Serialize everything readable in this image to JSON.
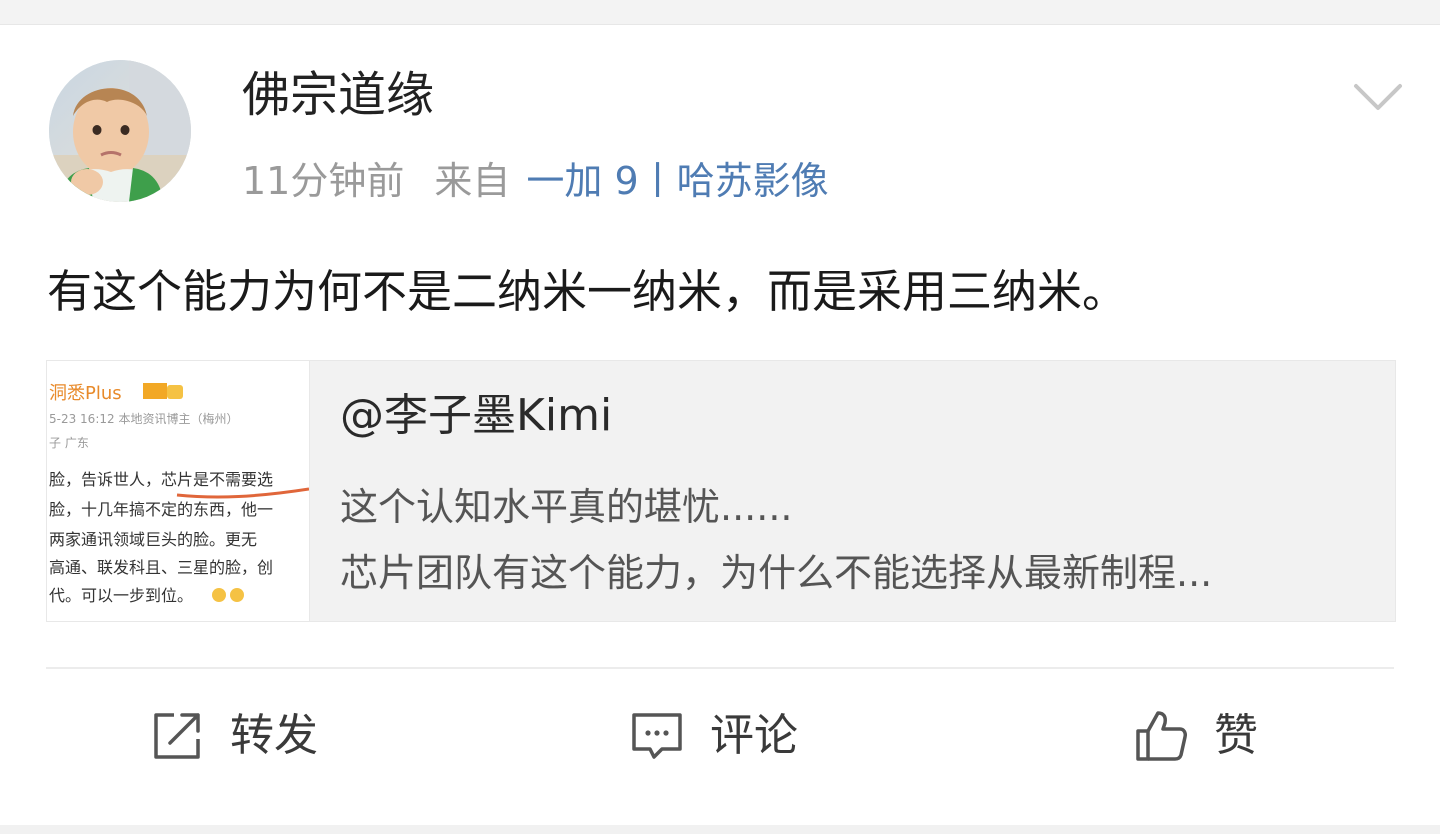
{
  "post": {
    "username": "佛宗道缘",
    "time": "11分钟前",
    "from_label": "来自",
    "device": "一加 9丨哈苏影像",
    "text": "有这个能力为何不是二纳米一纳米，而是采用三纳米。"
  },
  "repost": {
    "author": "@李子墨Kimi",
    "line1": "这个认知水平真的堪忧......",
    "line2": "芯片团队有这个能力，为什么不能选择从最新制程..."
  },
  "thumbnail": {
    "lines": [
      "洞悉Plus",
      "5-23 16:12 本地资讯博主（梅州）",
      "子 广东",
      "脸，告诉世人，芯片是不需要选",
      "脸，十几年搞不定的东西，他一",
      "两家通讯领域巨头的脸。更无",
      "高通、联发科且、三星的脸，创",
      "代。可以一步到位。"
    ]
  },
  "actions": {
    "repost_label": "转发",
    "comment_label": "评论",
    "like_label": "赞"
  },
  "icons": {
    "dropdown": "chevron-down-icon",
    "repost": "share-icon",
    "comment": "comment-icon",
    "like": "thumbs-up-icon"
  },
  "colors": {
    "link": "#4f7cb3",
    "meta": "#9a9a9a",
    "text": "#1a1a1a",
    "card_bg": "#f2f2f2"
  }
}
